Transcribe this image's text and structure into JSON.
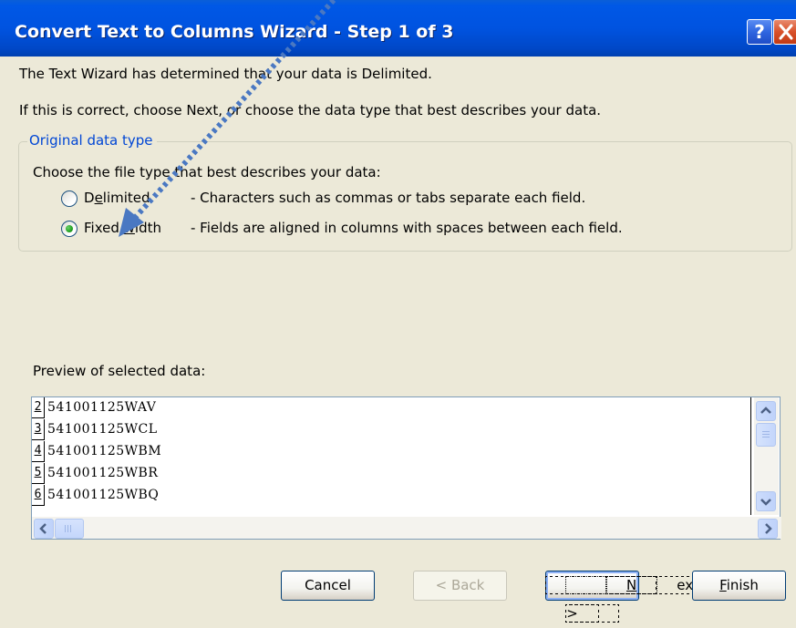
{
  "window": {
    "title": "Convert Text to Columns Wizard - Step 1 of 3",
    "help_glyph": "?",
    "close_glyph": "X"
  },
  "intro": {
    "line1": "The Text Wizard has determined that your data is Delimited.",
    "line2": "If this is correct, choose Next, or choose the data type that best describes your data."
  },
  "group": {
    "legend": "Original data type",
    "prompt": "Choose the file type that best describes your data:",
    "options": [
      {
        "label_pre": "D",
        "label_ul": "e",
        "label_post": "limited",
        "description": "- Characters such as commas or tabs separate each field.",
        "selected": false
      },
      {
        "label_pre": "Fixed ",
        "label_ul": "w",
        "label_post": "idth",
        "description": "- Fields are aligned in columns with spaces between each field.",
        "selected": true
      }
    ]
  },
  "preview": {
    "label": "Preview of selected data:",
    "rows": [
      {
        "num": "2",
        "data": "541001125WAV"
      },
      {
        "num": "3",
        "data": "541001125WCL"
      },
      {
        "num": "4",
        "data": "541001125WBM"
      },
      {
        "num": "5",
        "data": "541001125WBR"
      },
      {
        "num": "6",
        "data": "541001125WBQ"
      }
    ]
  },
  "buttons": {
    "cancel": "Cancel",
    "back": "< Back",
    "next_pre": "",
    "next_ul": "N",
    "next_post": "ext >",
    "finish_pre": "",
    "finish_ul": "F",
    "finish_post": "inish"
  },
  "colors": {
    "title_bar": "#0053E0",
    "legend_text": "#0046D5",
    "annotation_arrow": "#4A78C2"
  }
}
